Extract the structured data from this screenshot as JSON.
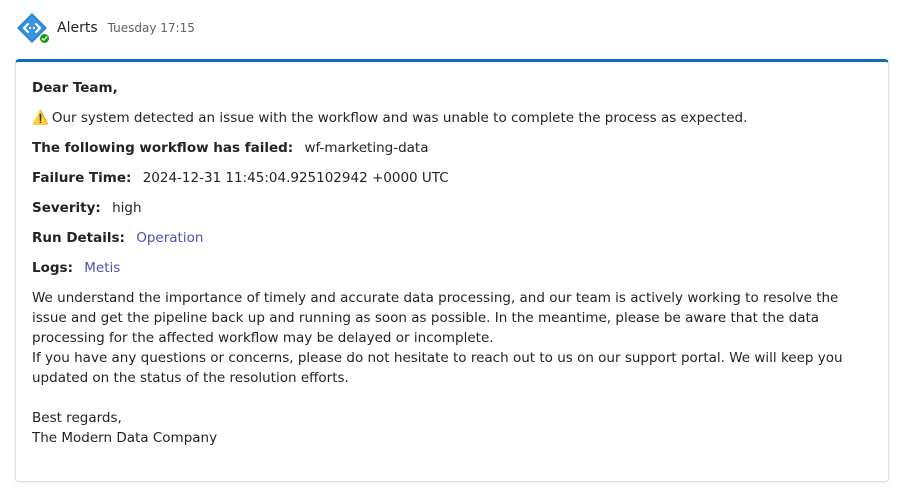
{
  "header": {
    "sender": "Alerts",
    "timestamp": "Tuesday 17:15",
    "avatar_icon": "bot-diamond-icon",
    "presence_icon": "available-check-icon",
    "accent_color": "#0f6cbd"
  },
  "message": {
    "greeting": "Dear Team,",
    "warning_icon": "⚠️",
    "intro": "Our system detected an issue with the workflow and was unable to complete the process as expected.",
    "fields": {
      "workflow_label": "The following workflow has failed:",
      "workflow_value": "wf-marketing-data",
      "time_label": "Failure Time:",
      "time_value": "2024-12-31 11:45:04.925102942 +0000 UTC",
      "severity_label": "Severity:",
      "severity_value": "high",
      "run_label": "Run Details:",
      "run_link": "Operation",
      "logs_label": "Logs:",
      "logs_link": "Metis"
    },
    "body_1": "We understand the importance of timely and accurate data processing, and our team is actively working to resolve the issue and get the pipeline back up and running as soon as possible. In the meantime, please be aware that the data processing for the affected workflow may be delayed or incomplete.",
    "body_2": "If you have any questions or concerns, please do not hesitate to reach out to us on our support portal. We will keep you updated on the status of the resolution efforts.",
    "closing": "Best regards,",
    "signature": "The Modern Data Company"
  }
}
